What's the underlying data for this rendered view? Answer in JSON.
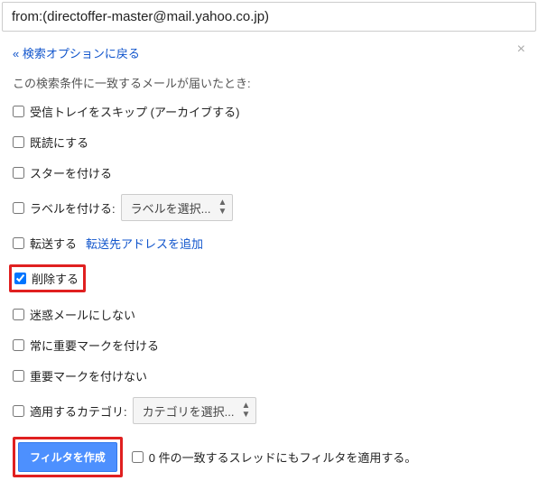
{
  "search": {
    "query": "from:(directoffer-master@mail.yahoo.co.jp)"
  },
  "backLink": "« 検索オプションに戻る",
  "intro": "この検索条件に一致するメールが届いたとき:",
  "options": {
    "skipInbox": "受信トレイをスキップ (アーカイブする)",
    "markRead": "既読にする",
    "star": "スターを付ける",
    "applyLabel": "ラベルを付ける:",
    "labelSelect": "ラベルを選択...",
    "forward": "転送する",
    "forwardLink": "転送先アドレスを追加",
    "delete": "削除する",
    "neverSpam": "迷惑メールにしない",
    "alwaysImportant": "常に重要マークを付ける",
    "neverImportant": "重要マークを付けない",
    "categorize": "適用するカテゴリ:",
    "categorySelect": "カテゴリを選択..."
  },
  "footer": {
    "createBtn": "フィルタを作成",
    "alsoApply": "0 件の一致するスレッドにもフィルタを適用する。"
  }
}
